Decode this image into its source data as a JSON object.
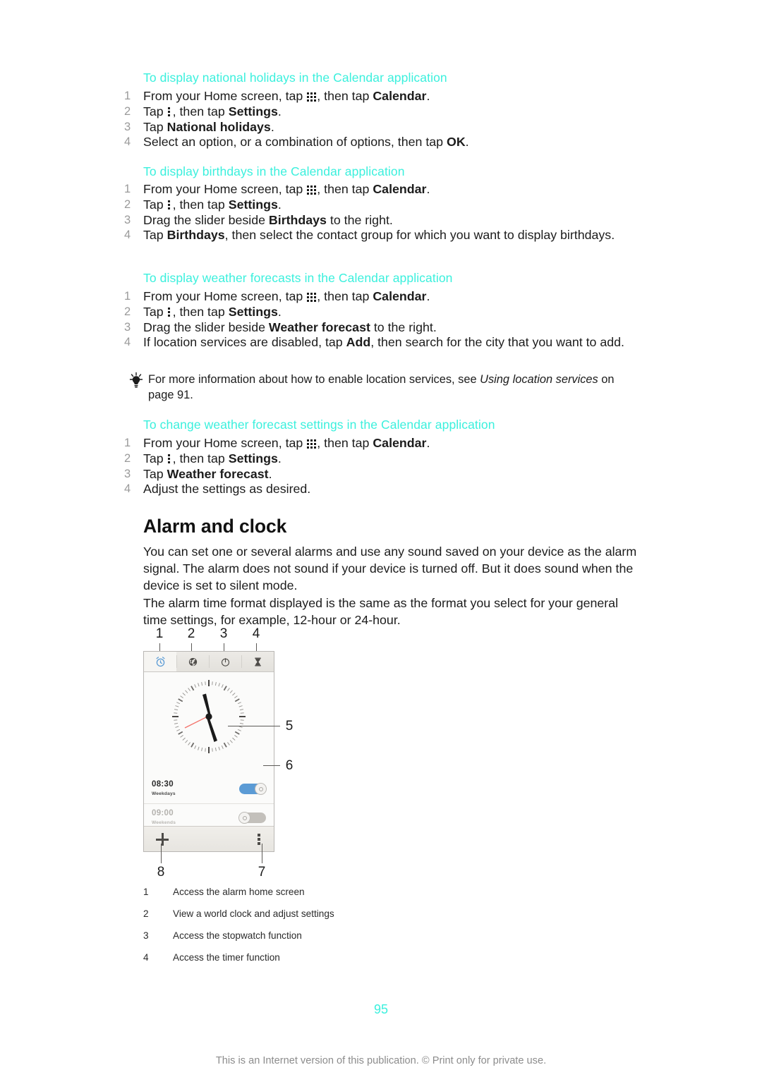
{
  "colors": {
    "accent_cyan": "#3bf0dd",
    "toggle_on_blue": "#5b9bd5",
    "toggle_off_grey": "#c3c0bb",
    "second_hand_red": "#f4736b",
    "active_tab_icon": "#5b9bd5",
    "footer_grey": "#8c8c8c",
    "step_number_grey": "#9a9a9a"
  },
  "sections": [
    {
      "heading": "To display national holidays in the Calendar application",
      "steps": [
        {
          "num": "1",
          "parts": [
            {
              "t": "text",
              "v": "From your Home screen, tap "
            },
            {
              "t": "icon",
              "v": "app-drawer-grid-icon"
            },
            {
              "t": "text",
              "v": ", then tap "
            },
            {
              "t": "bold",
              "v": "Calendar"
            },
            {
              "t": "text",
              "v": "."
            }
          ]
        },
        {
          "num": "2",
          "parts": [
            {
              "t": "text",
              "v": "Tap "
            },
            {
              "t": "icon",
              "v": "overflow-menu-icon"
            },
            {
              "t": "text",
              "v": ", then tap "
            },
            {
              "t": "bold",
              "v": "Settings"
            },
            {
              "t": "text",
              "v": "."
            }
          ]
        },
        {
          "num": "3",
          "parts": [
            {
              "t": "text",
              "v": "Tap "
            },
            {
              "t": "bold",
              "v": "National holidays"
            },
            {
              "t": "text",
              "v": "."
            }
          ]
        },
        {
          "num": "4",
          "parts": [
            {
              "t": "text",
              "v": "Select an option, or a combination of options, then tap "
            },
            {
              "t": "bold",
              "v": "OK"
            },
            {
              "t": "text",
              "v": "."
            }
          ]
        }
      ]
    },
    {
      "heading": "To display birthdays in the Calendar application",
      "steps": [
        {
          "num": "1",
          "parts": [
            {
              "t": "text",
              "v": "From your Home screen, tap "
            },
            {
              "t": "icon",
              "v": "app-drawer-grid-icon"
            },
            {
              "t": "text",
              "v": ", then tap "
            },
            {
              "t": "bold",
              "v": "Calendar"
            },
            {
              "t": "text",
              "v": "."
            }
          ]
        },
        {
          "num": "2",
          "parts": [
            {
              "t": "text",
              "v": "Tap "
            },
            {
              "t": "icon",
              "v": "overflow-menu-icon"
            },
            {
              "t": "text",
              "v": ", then tap "
            },
            {
              "t": "bold",
              "v": "Settings"
            },
            {
              "t": "text",
              "v": "."
            }
          ]
        },
        {
          "num": "3",
          "parts": [
            {
              "t": "text",
              "v": "Drag the slider beside "
            },
            {
              "t": "bold",
              "v": "Birthdays"
            },
            {
              "t": "text",
              "v": " to the right."
            }
          ]
        },
        {
          "num": "4",
          "parts": [
            {
              "t": "text",
              "v": "Tap "
            },
            {
              "t": "bold",
              "v": "Birthdays"
            },
            {
              "t": "text",
              "v": ", then select the contact group for which you want to display birthdays."
            }
          ]
        }
      ]
    },
    {
      "heading": "To display weather forecasts in the Calendar application",
      "steps": [
        {
          "num": "1",
          "parts": [
            {
              "t": "text",
              "v": "From your Home screen, tap "
            },
            {
              "t": "icon",
              "v": "app-drawer-grid-icon"
            },
            {
              "t": "text",
              "v": ", then tap "
            },
            {
              "t": "bold",
              "v": "Calendar"
            },
            {
              "t": "text",
              "v": "."
            }
          ]
        },
        {
          "num": "2",
          "parts": [
            {
              "t": "text",
              "v": "Tap "
            },
            {
              "t": "icon",
              "v": "overflow-menu-icon"
            },
            {
              "t": "text",
              "v": ", then tap "
            },
            {
              "t": "bold",
              "v": "Settings"
            },
            {
              "t": "text",
              "v": "."
            }
          ]
        },
        {
          "num": "3",
          "parts": [
            {
              "t": "text",
              "v": "Drag the slider beside "
            },
            {
              "t": "bold",
              "v": "Weather forecast"
            },
            {
              "t": "text",
              "v": " to the right."
            }
          ]
        },
        {
          "num": "4",
          "parts": [
            {
              "t": "text",
              "v": "If location services are disabled, tap "
            },
            {
              "t": "bold",
              "v": "Add"
            },
            {
              "t": "text",
              "v": ", then search for the city that you want to add."
            }
          ]
        }
      ]
    },
    {
      "heading": "To change weather forecast settings in the Calendar application",
      "steps": [
        {
          "num": "1",
          "parts": [
            {
              "t": "text",
              "v": "From your Home screen, tap "
            },
            {
              "t": "icon",
              "v": "app-drawer-grid-icon"
            },
            {
              "t": "text",
              "v": ", then tap "
            },
            {
              "t": "bold",
              "v": "Calendar"
            },
            {
              "t": "text",
              "v": "."
            }
          ]
        },
        {
          "num": "2",
          "parts": [
            {
              "t": "text",
              "v": "Tap "
            },
            {
              "t": "icon",
              "v": "overflow-menu-icon"
            },
            {
              "t": "text",
              "v": ", then tap "
            },
            {
              "t": "bold",
              "v": "Settings"
            },
            {
              "t": "text",
              "v": "."
            }
          ]
        },
        {
          "num": "3",
          "parts": [
            {
              "t": "text",
              "v": "Tap "
            },
            {
              "t": "bold",
              "v": "Weather forecast"
            },
            {
              "t": "text",
              "v": "."
            }
          ]
        },
        {
          "num": "4",
          "parts": [
            {
              "t": "text",
              "v": "Adjust the settings as desired."
            }
          ]
        }
      ]
    }
  ],
  "tip": {
    "icon": "lightbulb-icon",
    "parts": [
      {
        "t": "text",
        "v": "For more information about how to enable location services, see "
      },
      {
        "t": "italic",
        "v": "Using location services"
      },
      {
        "t": "text",
        "v": " on page 91."
      }
    ]
  },
  "alarm_section": {
    "title": "Alarm and clock",
    "paragraphs": [
      "You can set one or several alarms and use any sound saved on your device as the alarm signal. The alarm does not sound if your device is turned off. But it does sound when the device is set to silent mode.",
      "The alarm time format displayed is the same as the format you select for your general time settings, for example, 12-hour or 24-hour."
    ]
  },
  "illustration": {
    "callouts": [
      "1",
      "2",
      "3",
      "4",
      "5",
      "6",
      "7",
      "8"
    ],
    "tabs": [
      {
        "name": "alarm-tab",
        "icon": "alarm-clock-icon",
        "active": true
      },
      {
        "name": "world-clock-tab",
        "icon": "globe-icon",
        "active": false
      },
      {
        "name": "stopwatch-tab",
        "icon": "stopwatch-icon",
        "active": false
      },
      {
        "name": "timer-tab",
        "icon": "hourglass-icon",
        "active": false
      }
    ],
    "clock": {
      "icon": "analog-clock-face"
    },
    "alarms": [
      {
        "time": "08:30",
        "days": "Weekdays",
        "enabled": true
      },
      {
        "time": "09:00",
        "days": "Weekends",
        "enabled": false
      }
    ],
    "bottom_bar": {
      "add_icon": "plus-icon",
      "overflow_icon": "overflow-menu-icon"
    }
  },
  "caption_list": [
    {
      "num": "1",
      "text": "Access the alarm home screen"
    },
    {
      "num": "2",
      "text": "View a world clock and adjust settings"
    },
    {
      "num": "3",
      "text": "Access the stopwatch function"
    },
    {
      "num": "4",
      "text": "Access the timer function"
    }
  ],
  "footer": {
    "page_number": "95",
    "note": "This is an Internet version of this publication. © Print only for private use."
  }
}
